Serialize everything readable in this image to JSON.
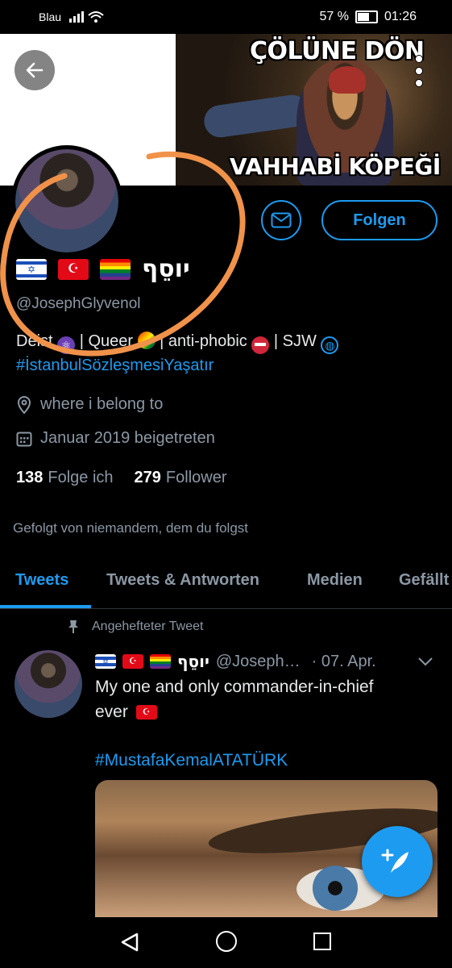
{
  "status_bar": {
    "carrier": "Blau",
    "battery": "57 %",
    "battery_level": 0.57,
    "time": "01:26"
  },
  "banner": {
    "meme_top": "ÇÖLÜNE DÖN",
    "meme_bottom": "VAHHABİ KÖPEĞİ"
  },
  "profile": {
    "display_name": "יוסֵף",
    "handle": "@JosephGlyvenol",
    "follow_label": "Folgen",
    "bio_line1": {
      "a": "Deist",
      "b": "| Queer",
      "c": "| anti-phobic",
      "d": "| SJW"
    },
    "bio_hashtag": "#İstanbulSözleşmesiYaşatır",
    "location": "where i belong to",
    "joined": "Januar 2019 beigetreten",
    "following_count": "138",
    "following_label": "Folge ich",
    "followers_count": "279",
    "followers_label": "Follower",
    "followed_by": "Gefolgt von niemandem, dem du folgst"
  },
  "tabs": [
    "Tweets",
    "Tweets & Antworten",
    "Medien",
    "Gefällt"
  ],
  "pinned_tweet": {
    "pinned_label": "Angehefteter Tweet",
    "name": "יוסֵף",
    "handle": "@Joseph…",
    "date": "· 07. Apr.",
    "text_line1": "My one and only commander-in-chief",
    "text_line2": "ever",
    "hashtag": "#MustafaKemalATATÜRK"
  },
  "colors": {
    "accent": "#1d9bf0",
    "annotation": "#f0924a",
    "background": "#000000"
  }
}
